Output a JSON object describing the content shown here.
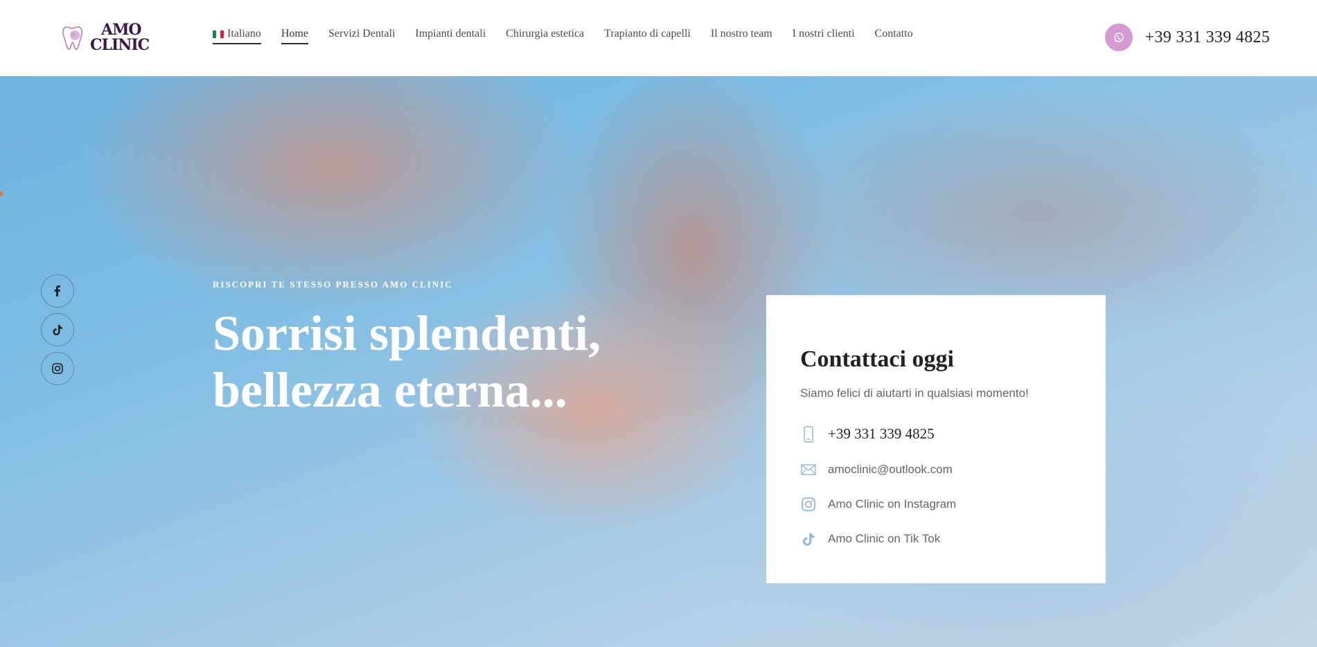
{
  "brand": {
    "line1": "AMO",
    "line2": "CLINIC"
  },
  "nav": {
    "language": "Italiano",
    "items": [
      {
        "label": "Home",
        "active": true
      },
      {
        "label": "Servizi Dentali"
      },
      {
        "label": "Impianti dentali"
      },
      {
        "label": "Chirurgia estetica"
      },
      {
        "label": "Trapianto di capelli"
      },
      {
        "label": "Il nostro team"
      },
      {
        "label": "I nostri clienti"
      },
      {
        "label": "Contatto"
      }
    ]
  },
  "header_phone": "+39 331 339 4825",
  "hero": {
    "kicker": "RISCOPRI TE STESSO PRESSO AMO CLINIC",
    "title_line1": "Sorrisi splendenti,",
    "title_line2": "bellezza eterna..."
  },
  "social": [
    {
      "icon": "facebook-icon"
    },
    {
      "icon": "tiktok-icon"
    },
    {
      "icon": "instagram-icon"
    }
  ],
  "contact_card": {
    "title": "Contattaci oggi",
    "subtitle": "Siamo felici di aiutarti in qualsiasi momento!",
    "phone": "+39 331 339 4825",
    "email": "amoclinic@outlook.com",
    "instagram": "Amo Clinic on Instagram",
    "tiktok": "Amo Clinic on Tik Tok"
  },
  "colors": {
    "accent_pink": "#d59ad1",
    "icon_blue": "#8fb8d8",
    "brand_purple": "#3a1a4a"
  }
}
